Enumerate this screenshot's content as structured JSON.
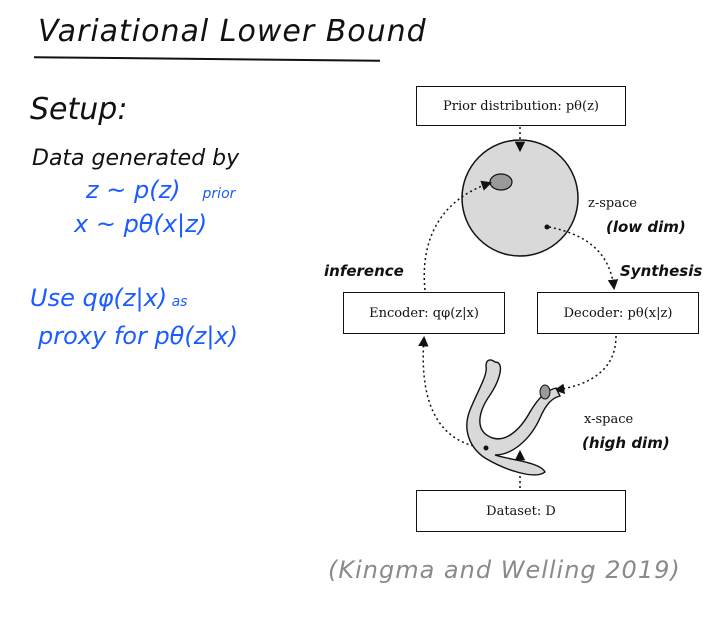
{
  "title": "Variational Lower Bound",
  "notes": {
    "setup": "Setup:",
    "line1": "Data generated by",
    "z_eq": "z ~ p(z)",
    "z_prior": "prior",
    "x_eq": "x ~ pθ(x|z)",
    "use_a": "Use ",
    "use_q": "qφ(z|x)",
    "use_as": " as",
    "proxy": "proxy for pθ(z|x)"
  },
  "diagram": {
    "prior_box": "Prior distribution: pθ(z)",
    "encoder_box": "Encoder: qφ(z|x)",
    "decoder_box": "Decoder: pθ(x|z)",
    "dataset_box": "Dataset: D",
    "z_space": "z-space",
    "low_dim": "(low dim)",
    "x_space": "x-space",
    "high_dim": "(high dim)",
    "inference": "inference",
    "synthesis": "Synthesis"
  },
  "citation": "(Kingma and Welling 2019)"
}
